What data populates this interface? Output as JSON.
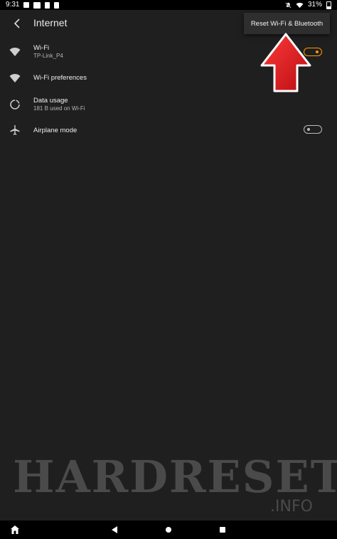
{
  "status_bar": {
    "time": "9:31",
    "battery": "31%"
  },
  "toolbar": {
    "title": "Internet"
  },
  "menu": {
    "reset_label": "Reset Wi-Fi & Bluetooth"
  },
  "items": [
    {
      "title": "Wi-Fi",
      "subtitle": "TP-Link_P4",
      "icon": "wifi-icon",
      "toggle": "on"
    },
    {
      "title": "Wi-Fi preferences",
      "subtitle": "",
      "icon": "wifi-icon"
    },
    {
      "title": "Data usage",
      "subtitle": "181 B used on Wi-Fi",
      "icon": "data-usage-icon"
    },
    {
      "title": "Airplane mode",
      "subtitle": "",
      "icon": "airplane-icon",
      "toggle": "off"
    }
  ],
  "watermark": {
    "main": "HARDRESET",
    "sub": ".INFO"
  },
  "colors": {
    "accent": "#ff9900",
    "background": "#1f1f1f",
    "arrow": "#e0151b"
  }
}
